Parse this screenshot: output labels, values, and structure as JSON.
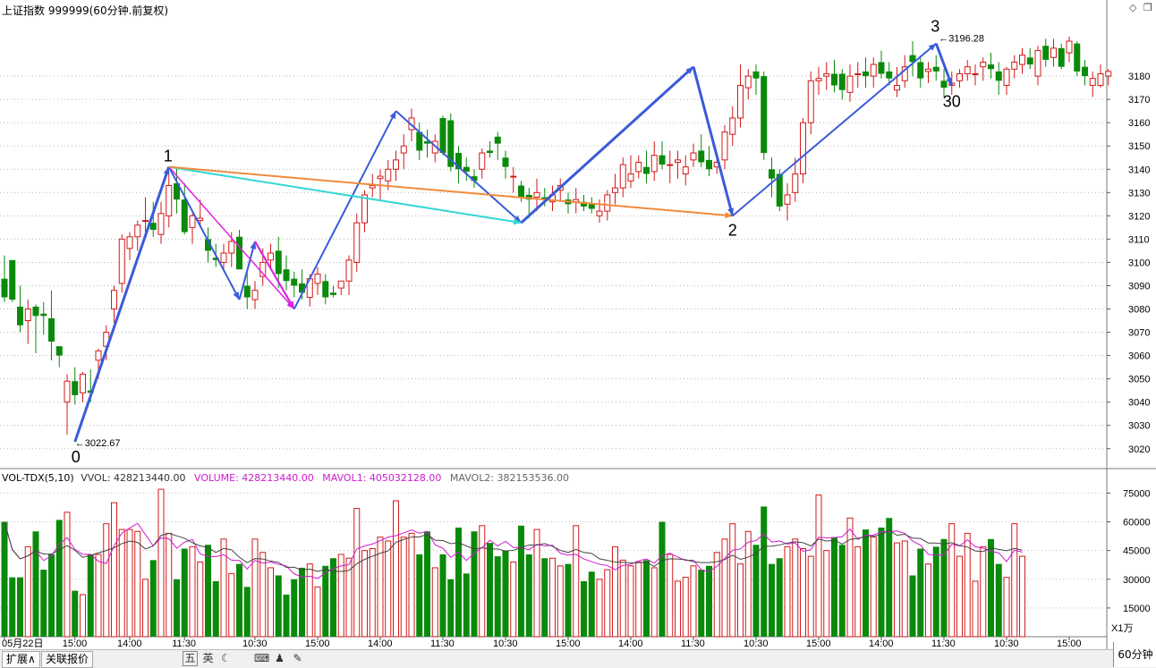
{
  "window": {
    "title": "上证指数 999999(60分钟.前复权)",
    "icons": [
      "diamond-icon",
      "restore-window-icon"
    ]
  },
  "chart_data": [
    {
      "type": "candlestick",
      "title": "上证指数 999999(60分钟.前复权)",
      "y_axis_ticks": [
        3020,
        3030,
        3040,
        3050,
        3060,
        3070,
        3080,
        3090,
        3100,
        3110,
        3120,
        3130,
        3140,
        3150,
        3160,
        3170,
        3180
      ],
      "ylim": [
        3013,
        3205
      ],
      "grid": true,
      "colors": {
        "up": "#d11a1a",
        "down": "#0a8a0a"
      },
      "candles_ohlc": [
        [
          3093,
          3103,
          3083,
          3085
        ],
        [
          3101,
          3101,
          3083,
          3084
        ],
        [
          3081,
          3090,
          3070,
          3073
        ],
        [
          3075,
          3084,
          3065,
          3080
        ],
        [
          3081,
          3082,
          3061,
          3077
        ],
        [
          3078,
          3083,
          3069,
          3077
        ],
        [
          3076,
          3088,
          3058,
          3066
        ],
        [
          3064,
          3064,
          3055,
          3060
        ],
        [
          3040,
          3052,
          3026,
          3049
        ],
        [
          3049,
          3055,
          3039,
          3043
        ],
        [
          3044,
          3053,
          3040,
          3052
        ],
        [
          3045,
          3054,
          3040,
          3044
        ],
        [
          3058,
          3063,
          3050,
          3062
        ],
        [
          3064,
          3073,
          3058,
          3070
        ],
        [
          3080,
          3090,
          3074,
          3088
        ],
        [
          3091,
          3112,
          3087,
          3110
        ],
        [
          3106,
          3113,
          3101,
          3111
        ],
        [
          3111,
          3118,
          3105,
          3116
        ],
        [
          3118,
          3128,
          3112,
          3118
        ],
        [
          3117,
          3126,
          3111,
          3114
        ],
        [
          3112,
          3126,
          3108,
          3121
        ],
        [
          3120,
          3138,
          3115,
          3133
        ],
        [
          3134,
          3141,
          3121,
          3127
        ],
        [
          3127,
          3134,
          3112,
          3113
        ],
        [
          3115,
          3121,
          3108,
          3120
        ],
        [
          3118,
          3127,
          3115,
          3119
        ],
        [
          3110,
          3115,
          3100,
          3105
        ],
        [
          3102,
          3108,
          3098,
          3101
        ],
        [
          3100,
          3108,
          3097,
          3104
        ],
        [
          3104,
          3113,
          3098,
          3109
        ],
        [
          3111,
          3114,
          3097,
          3097
        ],
        [
          3090,
          3096,
          3080,
          3085
        ],
        [
          3084,
          3092,
          3080,
          3088
        ],
        [
          3094,
          3106,
          3090,
          3100
        ],
        [
          3101,
          3108,
          3097,
          3104
        ],
        [
          3105,
          3111,
          3089,
          3095
        ],
        [
          3097,
          3103,
          3088,
          3092
        ],
        [
          3093,
          3096,
          3085,
          3090
        ],
        [
          3091,
          3097,
          3084,
          3087
        ],
        [
          3085,
          3095,
          3081,
          3093
        ],
        [
          3091,
          3098,
          3086,
          3095
        ],
        [
          3092,
          3095,
          3082,
          3085
        ],
        [
          3087,
          3090,
          3085,
          3086
        ],
        [
          3089,
          3092,
          3086,
          3092
        ],
        [
          3092,
          3103,
          3086,
          3101
        ],
        [
          3100,
          3121,
          3096,
          3117
        ],
        [
          3117,
          3131,
          3113,
          3129
        ],
        [
          3132,
          3138,
          3128,
          3133
        ],
        [
          3136,
          3140,
          3127,
          3137
        ],
        [
          3135,
          3144,
          3131,
          3140
        ],
        [
          3140,
          3148,
          3135,
          3144
        ],
        [
          3147,
          3155,
          3140,
          3150
        ],
        [
          3157,
          3166,
          3152,
          3162
        ],
        [
          3156,
          3160,
          3144,
          3148
        ],
        [
          3152,
          3157,
          3145,
          3151
        ],
        [
          3147,
          3155,
          3143,
          3152
        ],
        [
          3162,
          3163,
          3146,
          3147
        ],
        [
          3161,
          3164,
          3139,
          3141
        ],
        [
          3147,
          3150,
          3134,
          3140
        ],
        [
          3141,
          3145,
          3135,
          3139
        ],
        [
          3137,
          3140,
          3132,
          3135
        ],
        [
          3140,
          3149,
          3136,
          3147
        ],
        [
          3148,
          3152,
          3145,
          3147
        ],
        [
          3154,
          3156,
          3144,
          3151
        ],
        [
          3145,
          3148,
          3136,
          3141
        ],
        [
          3137,
          3141,
          3130,
          3137
        ],
        [
          3133,
          3135,
          3126,
          3128
        ],
        [
          3129,
          3132,
          3119,
          3127
        ],
        [
          3128,
          3136,
          3122,
          3130
        ],
        [
          3128,
          3132,
          3124,
          3127
        ],
        [
          3126,
          3133,
          3122,
          3129
        ],
        [
          3131,
          3136,
          3126,
          3133
        ],
        [
          3127,
          3130,
          3121,
          3125
        ],
        [
          3126,
          3132,
          3121,
          3127
        ],
        [
          3126,
          3129,
          3122,
          3124
        ],
        [
          3125,
          3128,
          3121,
          3123
        ],
        [
          3120,
          3127,
          3117,
          3122
        ],
        [
          3122,
          3131,
          3118,
          3129
        ],
        [
          3130,
          3138,
          3125,
          3132
        ],
        [
          3132,
          3145,
          3128,
          3142
        ],
        [
          3135,
          3146,
          3132,
          3138
        ],
        [
          3139,
          3146,
          3136,
          3143
        ],
        [
          3141,
          3148,
          3134,
          3138
        ],
        [
          3139,
          3152,
          3135,
          3146
        ],
        [
          3146,
          3152,
          3140,
          3142
        ],
        [
          3142,
          3148,
          3134,
          3142
        ],
        [
          3143,
          3148,
          3136,
          3144
        ],
        [
          3138,
          3146,
          3133,
          3141
        ],
        [
          3144,
          3151,
          3141,
          3147
        ],
        [
          3148,
          3155,
          3141,
          3143
        ],
        [
          3144,
          3150,
          3137,
          3140
        ],
        [
          3141,
          3147,
          3138,
          3143
        ],
        [
          3144,
          3159,
          3140,
          3156
        ],
        [
          3155,
          3167,
          3150,
          3162
        ],
        [
          3162,
          3185,
          3158,
          3176
        ],
        [
          3175,
          3183,
          3170,
          3180
        ],
        [
          3182,
          3185,
          3172,
          3179
        ],
        [
          3180,
          3182,
          3144,
          3147
        ],
        [
          3140,
          3145,
          3128,
          3136
        ],
        [
          3138,
          3140,
          3122,
          3124
        ],
        [
          3125,
          3134,
          3118,
          3129
        ],
        [
          3130,
          3145,
          3126,
          3138
        ],
        [
          3138,
          3162,
          3134,
          3160
        ],
        [
          3160,
          3182,
          3155,
          3178
        ],
        [
          3178,
          3184,
          3172,
          3179
        ],
        [
          3180,
          3186,
          3174,
          3181
        ],
        [
          3181,
          3187,
          3173,
          3176
        ],
        [
          3181,
          3183,
          3170,
          3174
        ],
        [
          3173,
          3185,
          3169,
          3180
        ],
        [
          3181,
          3186,
          3175,
          3181
        ],
        [
          3182,
          3188,
          3175,
          3180
        ],
        [
          3180,
          3188,
          3175,
          3185
        ],
        [
          3186,
          3191,
          3179,
          3181
        ],
        [
          3182,
          3186,
          3176,
          3179
        ],
        [
          3174,
          3184,
          3171,
          3176
        ],
        [
          3178,
          3189,
          3175,
          3184
        ],
        [
          3189,
          3195,
          3180,
          3186
        ],
        [
          3186,
          3188,
          3175,
          3179
        ],
        [
          3182,
          3186,
          3177,
          3183
        ],
        [
          3184,
          3189,
          3178,
          3182
        ],
        [
          3178,
          3183,
          3171,
          3175
        ],
        [
          3176,
          3182,
          3172,
          3177
        ],
        [
          3178,
          3183,
          3175,
          3181
        ],
        [
          3181,
          3187,
          3178,
          3184
        ],
        [
          3181,
          3185,
          3176,
          3181
        ],
        [
          3184,
          3188,
          3178,
          3186
        ],
        [
          3185,
          3190,
          3179,
          3183
        ],
        [
          3182,
          3186,
          3172,
          3178
        ],
        [
          3176,
          3184,
          3172,
          3183
        ],
        [
          3183,
          3189,
          3179,
          3186
        ],
        [
          3185,
          3192,
          3181,
          3189
        ],
        [
          3188,
          3192,
          3183,
          3185
        ],
        [
          3180,
          3193,
          3176,
          3191
        ],
        [
          3193,
          3196,
          3184,
          3187
        ],
        [
          3188,
          3196,
          3184,
          3192
        ],
        [
          3192,
          3194,
          3183,
          3184
        ],
        [
          3190,
          3197,
          3186,
          3195
        ],
        [
          3194,
          3195,
          3180,
          3182
        ],
        [
          3184,
          3187,
          3176,
          3180
        ],
        [
          3176,
          3182,
          3171,
          3179
        ],
        [
          3176,
          3185,
          3175,
          3181
        ],
        [
          3180,
          3183,
          3176,
          3182
        ]
      ],
      "extreme_labels": [
        {
          "text": "3022.67",
          "value": 3022.67
        },
        {
          "text": "3196.28",
          "value": 3196.28
        }
      ],
      "wave_labels": [
        "0",
        "1",
        "2",
        "3",
        "30"
      ],
      "wave_lines": [
        {
          "from": [
            9,
            3023
          ],
          "to": [
            21,
            3141
          ],
          "color": "#3a5bd9",
          "width": 3
        },
        {
          "from": [
            21,
            3141
          ],
          "to": [
            30,
            3084
          ],
          "color": "#3a5bd9",
          "width": 2
        },
        {
          "from": [
            30,
            3084
          ],
          "to": [
            32,
            3109
          ],
          "color": "#3a5bd9",
          "width": 2
        },
        {
          "from": [
            32,
            3109
          ],
          "to": [
            37,
            3080
          ],
          "color": "#3a5bd9",
          "width": 2
        },
        {
          "from": [
            21,
            3141
          ],
          "to": [
            37,
            3080
          ],
          "color": "#e020e0",
          "width": 1.5
        },
        {
          "from": [
            32,
            3109
          ],
          "to": [
            37,
            3080
          ],
          "color": "#e020e0",
          "width": 2
        },
        {
          "from": [
            37,
            3080
          ],
          "to": [
            50,
            3165
          ],
          "color": "#3a5bd9",
          "width": 2
        },
        {
          "from": [
            50,
            3165
          ],
          "to": [
            66,
            3117
          ],
          "color": "#3a5bd9",
          "width": 2
        },
        {
          "from": [
            21,
            3141
          ],
          "to": [
            66,
            3117
          ],
          "color": "#33d6d6",
          "width": 2
        },
        {
          "from": [
            21,
            3141
          ],
          "to": [
            93,
            3120
          ],
          "color": "#f08a3c",
          "width": 2
        },
        {
          "from": [
            66,
            3117
          ],
          "to": [
            88,
            3184
          ],
          "color": "#3a5bd9",
          "width": 3
        },
        {
          "from": [
            88,
            3184
          ],
          "to": [
            93,
            3120
          ],
          "color": "#3a5bd9",
          "width": 3
        },
        {
          "from": [
            93,
            3120
          ],
          "to": [
            119,
            3194
          ],
          "color": "#3a5bd9",
          "width": 2
        },
        {
          "from": [
            119,
            3194
          ],
          "to": [
            121,
            3176
          ],
          "color": "#3a5bd9",
          "width": 3
        }
      ],
      "x_tick_labels": [
        "05月22日",
        "15:00",
        "14:00",
        "11:30",
        "10:30",
        "15:00",
        "14:00",
        "11:30",
        "10:30",
        "15:00",
        "14:00",
        "11:30",
        "10:30",
        "15:00",
        "14:00",
        "11:30",
        "10:30",
        "15:00"
      ]
    },
    {
      "type": "bar",
      "title": "VOL-TDX(5,10)",
      "legend": [
        {
          "text": "VOL-TDX(5,10)",
          "color": "#000000"
        },
        {
          "text": "VVOL: 428213440.00",
          "color": "#333333"
        },
        {
          "text": "VOLUME: 428213440.00",
          "color": "#d01ad0"
        },
        {
          "text": "MAVOL1: 405032128.00",
          "color": "#d01ad0"
        },
        {
          "text": "MAVOL2: 382153536.00",
          "color": "#555555"
        }
      ],
      "y_axis_ticks": [
        15000,
        30000,
        45000,
        60000,
        75000
      ],
      "ylim": [
        0,
        78000
      ],
      "unit_label": "X1万",
      "volumes": [
        60000,
        31000,
        31000,
        47000,
        55000,
        35000,
        43000,
        61000,
        65000,
        24000,
        22000,
        43000,
        43000,
        59000,
        70000,
        56000,
        56000,
        55000,
        30000,
        40000,
        77000,
        54000,
        30000,
        46000,
        47000,
        39000,
        48000,
        29000,
        51000,
        33000,
        38000,
        26000,
        51000,
        44000,
        36000,
        32000,
        22000,
        30000,
        36000,
        38000,
        26000,
        37000,
        41000,
        43000,
        41000,
        67000,
        45000,
        46000,
        52000,
        50000,
        71000,
        52000,
        54000,
        43000,
        55000,
        36000,
        43000,
        30000,
        57000,
        33000,
        55000,
        58000,
        49000,
        42000,
        45000,
        39000,
        58000,
        43000,
        56000,
        41000,
        41000,
        37000,
        38000,
        58000,
        29000,
        34000,
        30000,
        35000,
        47000,
        40000,
        37000,
        39000,
        40000,
        36000,
        60000,
        43000,
        29000,
        31000,
        37000,
        35000,
        37000,
        44000,
        51000,
        59000,
        38000,
        55000,
        48000,
        68000,
        38000,
        41000,
        47000,
        51000,
        46000,
        42000,
        74000,
        45000,
        52000,
        48000,
        62000,
        47000,
        56000,
        52000,
        57000,
        62000,
        49000,
        50000,
        32000,
        46000,
        38000,
        47000,
        51000,
        59000,
        42000,
        54000,
        29000,
        47000,
        51000,
        38000,
        31000,
        59000,
        42000
      ],
      "volume_colors_up_down": "red-hollow-up green-filled-down"
    }
  ],
  "bottom_bar": {
    "tabs": [
      "扩展∧",
      "关联报价"
    ],
    "tools": [
      "五",
      "英"
    ],
    "tool_icons": [
      "moon-icon",
      "keyboard-icon",
      "user-icon",
      "wrench-icon"
    ],
    "period": "60分钟"
  }
}
